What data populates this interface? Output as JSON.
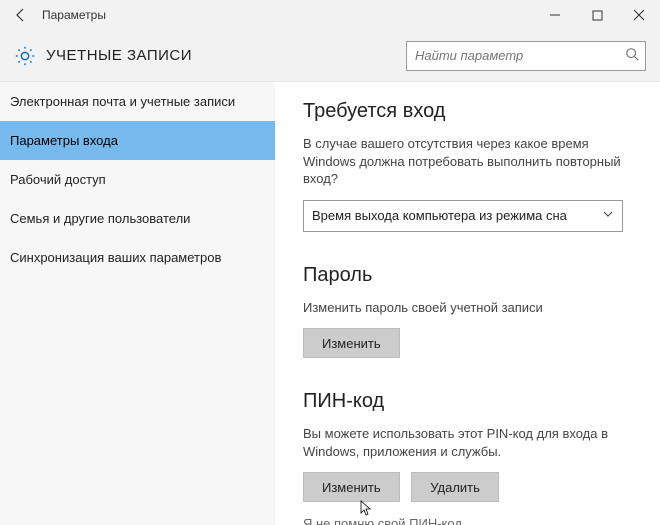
{
  "titlebar": {
    "title": "Параметры"
  },
  "header": {
    "page_title": "УЧЕТНЫЕ ЗАПИСИ",
    "search_placeholder": "Найти параметр"
  },
  "sidebar": {
    "items": [
      {
        "label": "Электронная почта и учетные записи"
      },
      {
        "label": "Параметры входа"
      },
      {
        "label": "Рабочий доступ"
      },
      {
        "label": "Семья и другие пользователи"
      },
      {
        "label": "Синхронизация ваших параметров"
      }
    ],
    "selected_index": 1
  },
  "main": {
    "signin": {
      "heading": "Требуется вход",
      "desc": "В случае вашего отсутствия через какое время Windows должна потребовать выполнить повторный вход?",
      "dropdown_value": "Время выхода компьютера из режима сна"
    },
    "password": {
      "heading": "Пароль",
      "desc": "Изменить пароль своей учетной записи",
      "change_label": "Изменить"
    },
    "pin": {
      "heading": "ПИН-код",
      "desc": "Вы можете использовать этот PIN-код для входа в Windows, приложения и службы.",
      "change_label": "Изменить",
      "remove_label": "Удалить",
      "forgot_label": "Я не помню свой ПИН-код"
    }
  }
}
